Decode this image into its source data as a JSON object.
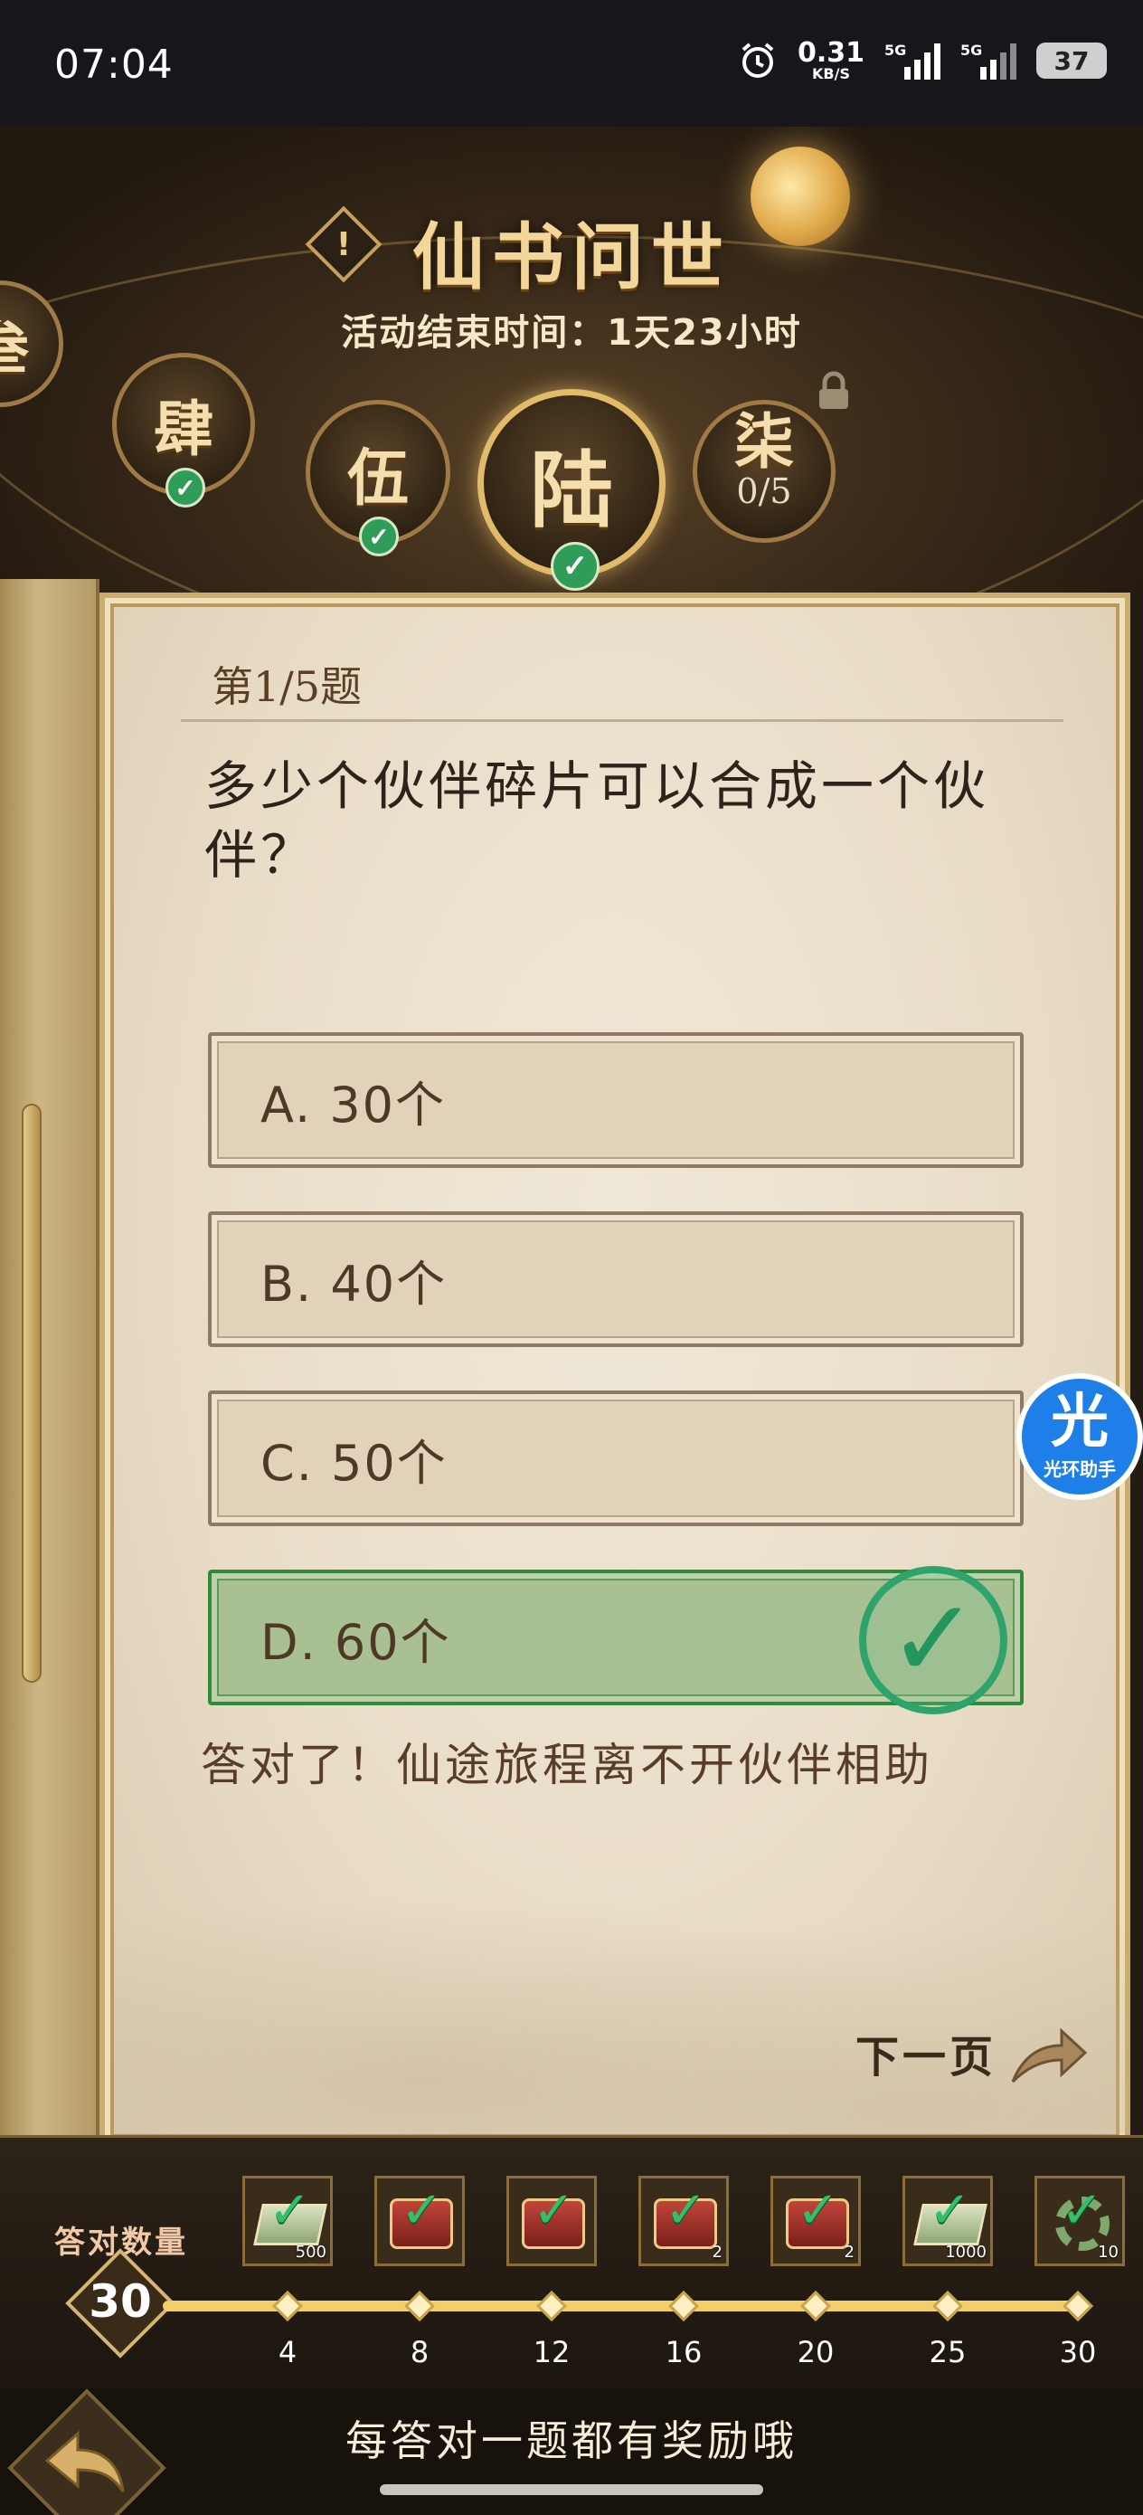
{
  "status_bar": {
    "time": "07:04",
    "net_speed_value": "0.31",
    "net_speed_unit": "KB/S",
    "sim1_label": "5G",
    "sim2_label": "5G",
    "battery": "37",
    "icons": [
      "alarm-icon",
      "signal-icon",
      "signal-icon",
      "battery-icon"
    ]
  },
  "header": {
    "title": "仙书问世",
    "end_time": "活动结束时间：1天23小时",
    "chapters": [
      {
        "label": "叁",
        "state": "completed"
      },
      {
        "label": "肆",
        "state": "completed"
      },
      {
        "label": "伍",
        "state": "completed"
      },
      {
        "label": "陆",
        "state": "active-completed"
      },
      {
        "label": "柒",
        "state": "locked",
        "progress": "0/5"
      }
    ]
  },
  "quiz": {
    "number": "第1/5题",
    "question": "多少个伙伴碎片可以合成一个伙伴？",
    "options": [
      {
        "label": "A. 30个",
        "correct": false
      },
      {
        "label": "B. 40个",
        "correct": false
      },
      {
        "label": "C. 50个",
        "correct": false
      },
      {
        "label": "D. 60个",
        "correct": true
      }
    ],
    "feedback": "答对了！仙途旅程离不开伙伴相助",
    "next_label": "下一页"
  },
  "helper": {
    "glyph": "光",
    "label": "光环助手"
  },
  "rewards": {
    "count_label": "答对数量",
    "count_value": "30",
    "milestones": [
      {
        "at": "4",
        "item": "book",
        "qty": "500"
      },
      {
        "at": "8",
        "item": "chest",
        "qty": ""
      },
      {
        "at": "12",
        "item": "chest",
        "qty": ""
      },
      {
        "at": "16",
        "item": "chest",
        "qty": "2"
      },
      {
        "at": "20",
        "item": "chest",
        "qty": "2"
      },
      {
        "at": "25",
        "item": "book",
        "qty": "1000"
      },
      {
        "at": "30",
        "item": "gear",
        "qty": "10"
      }
    ]
  },
  "footer": {
    "hint": "每答对一题都有奖励哦"
  },
  "colors": {
    "accent_gold": "#e2bb6a",
    "correct_green": "#2fa36c",
    "paper": "#e8dcc6"
  }
}
